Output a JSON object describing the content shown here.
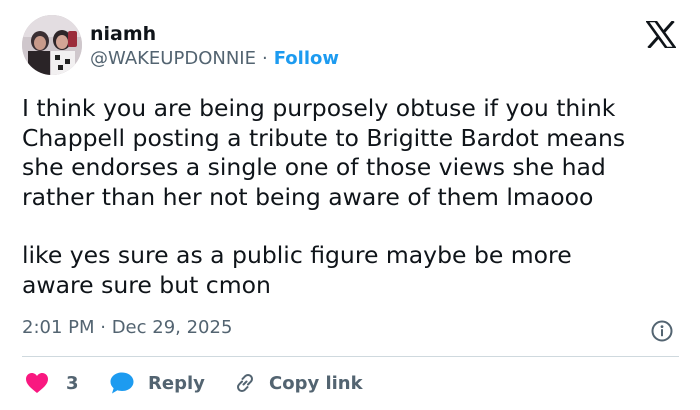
{
  "author": {
    "display_name": "niamh",
    "handle": "@WAKEUPDONNIE",
    "separator": "·",
    "follow_label": "Follow"
  },
  "tweet": {
    "lines_paragraph_1": [
      "I think you are being purposely obtuse if you think",
      "Chappell posting a tribute to Brigitte Bardot means",
      "she endorses a single one of those views she had",
      "rather than her not being aware of them lmaooo"
    ],
    "lines_paragraph_2": [
      "like yes sure as a public figure maybe be more",
      "aware sure but cmon"
    ],
    "timestamp": "2:01 PM · Dec 29, 2025"
  },
  "actions": {
    "like_count": "3",
    "reply_label": "Reply",
    "copy_link_label": "Copy link"
  },
  "icons": {
    "platform_logo": "x-logo",
    "info": "info-icon",
    "like": "heart-icon",
    "reply": "speech-bubble-icon",
    "copy": "link-icon"
  },
  "colors": {
    "text": "#0f1419",
    "secondary_text": "#536471",
    "accent": "#1d9bf0",
    "like": "#f91880",
    "divider": "#cfd9de"
  }
}
